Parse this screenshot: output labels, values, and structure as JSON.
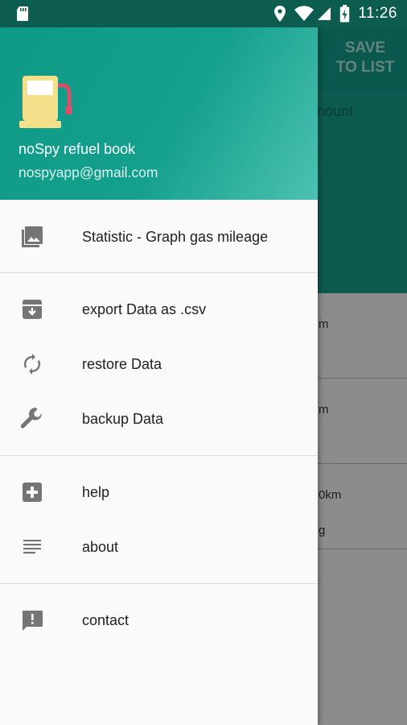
{
  "status_bar": {
    "time": "11:26",
    "icons": [
      "sd-card-icon",
      "location-icon",
      "wifi-icon",
      "signal-icon",
      "battery-icon"
    ]
  },
  "app": {
    "save_button": "SAVE\nTO LIST",
    "amount_label": "nount",
    "rows": [
      "m",
      "m",
      "0km",
      "g"
    ]
  },
  "drawer": {
    "header": {
      "app_name": "noSpy refuel book",
      "email": "nospyapp@gmail.com"
    },
    "items": [
      {
        "label": "Statistic - Graph gas mileage",
        "icon": "photo-icon"
      },
      {
        "label": "export Data as .csv",
        "icon": "archive-icon"
      },
      {
        "label": "restore Data",
        "icon": "sync-icon"
      },
      {
        "label": "backup Data",
        "icon": "wrench-icon"
      },
      {
        "label": "help",
        "icon": "plus-box-icon"
      },
      {
        "label": "about",
        "icon": "notes-icon"
      },
      {
        "label": "contact",
        "icon": "feedback-icon"
      }
    ]
  },
  "colors": {
    "status_bar": "#0c5c4f",
    "toolbar": "#14a38f",
    "header_start": "#0f9a87",
    "header_end": "#4cc1b2",
    "icon_gray": "#757575"
  }
}
